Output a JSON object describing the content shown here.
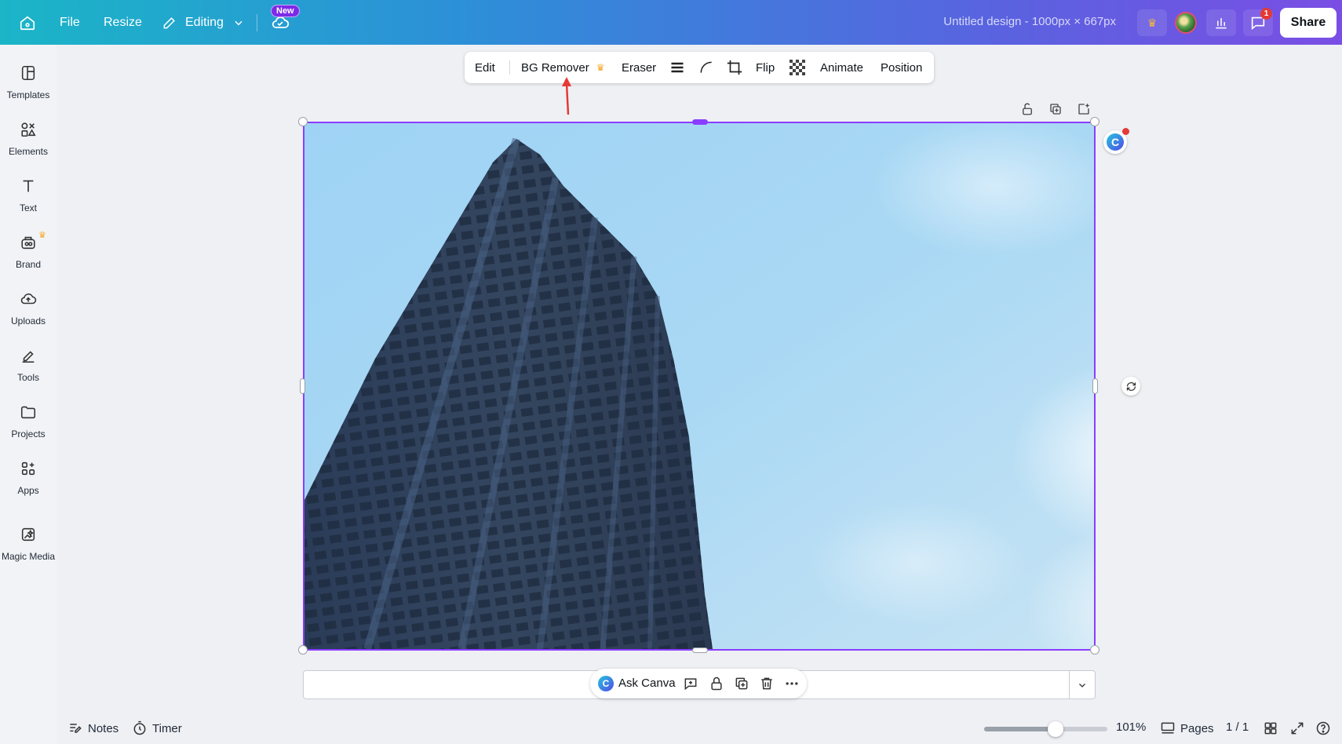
{
  "header": {
    "file_label": "File",
    "resize_label": "Resize",
    "editing_label": "Editing",
    "new_badge": "New",
    "design_title": "Untitled design - 1000px × 667px",
    "share_label": "Share",
    "notification_count": "1"
  },
  "sidebar": {
    "items": [
      {
        "label": "Templates",
        "icon": "templates-icon"
      },
      {
        "label": "Elements",
        "icon": "elements-icon"
      },
      {
        "label": "Text",
        "icon": "text-icon"
      },
      {
        "label": "Brand",
        "icon": "brand-icon"
      },
      {
        "label": "Uploads",
        "icon": "uploads-icon"
      },
      {
        "label": "Tools",
        "icon": "tools-icon"
      },
      {
        "label": "Projects",
        "icon": "projects-icon"
      },
      {
        "label": "Apps",
        "icon": "apps-icon"
      },
      {
        "label": "Magic Media",
        "icon": "magic-media-icon"
      }
    ]
  },
  "context_toolbar": {
    "edit": "Edit",
    "bg_remover": "BG Remover",
    "eraser": "Eraser",
    "flip": "Flip",
    "animate": "Animate",
    "position": "Position"
  },
  "canvas": {
    "image_subject": "Tall building against blue sky"
  },
  "ask_bar": {
    "label": "Ask Canva"
  },
  "footer": {
    "notes": "Notes",
    "timer": "Timer",
    "zoom": "101%",
    "zoom_fraction": 0.58,
    "pages": "Pages",
    "page_count": "1 / 1"
  },
  "colors": {
    "accent": "#8b3dff",
    "premium_crown": "#f5a623",
    "annotation_arrow": "#e53935"
  }
}
